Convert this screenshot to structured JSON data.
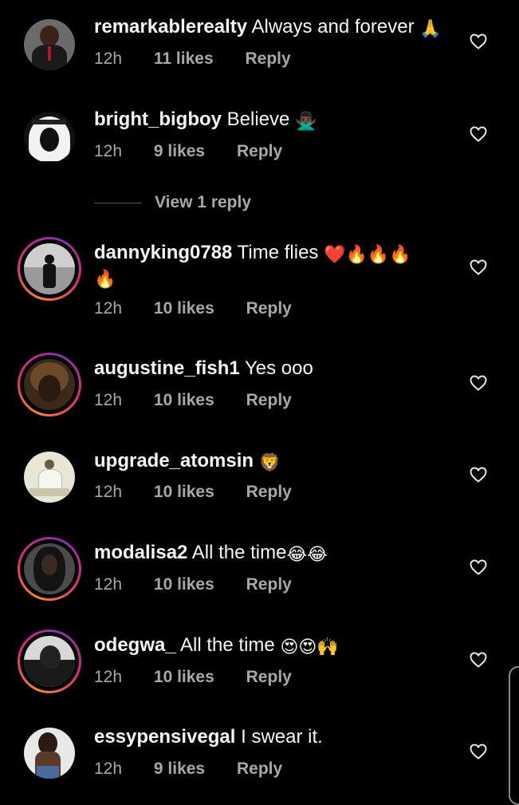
{
  "comments": [
    {
      "username": "remarkablerealty",
      "text": "Always and forever",
      "emoji": "🙏",
      "time": "12h",
      "likes": "11 likes",
      "reply": "Reply"
    },
    {
      "username": "bright_bigboy",
      "text": "Believe",
      "emoji": "🙅🏿‍♂️",
      "time": "12h",
      "likes": "9 likes",
      "reply": "Reply"
    },
    {
      "username": "dannyking0788",
      "text": "Time flies",
      "emoji": "❤️🔥🔥🔥",
      "emoji2": "🔥",
      "time": "12h",
      "likes": "10 likes",
      "reply": "Reply"
    },
    {
      "username": "augustine_fish1",
      "text": "Yes ooo",
      "emoji": "",
      "time": "12h",
      "likes": "10 likes",
      "reply": "Reply"
    },
    {
      "username": "upgrade_atomsin",
      "text": "",
      "emoji": "🦁",
      "time": "12h",
      "likes": "10 likes",
      "reply": "Reply"
    },
    {
      "username": "modalisa2",
      "text": "All the time",
      "emoji": "😂😂",
      "time": "12h",
      "likes": "10 likes",
      "reply": "Reply"
    },
    {
      "username": "odegwa_",
      "text": "All the time",
      "emoji": "😍😍🙌",
      "time": "12h",
      "likes": "10 likes",
      "reply": "Reply"
    },
    {
      "username": "essypensivegal",
      "text": "I swear it.",
      "emoji": "",
      "time": "12h",
      "likes": "9 likes",
      "reply": "Reply"
    }
  ],
  "view_replies_label": "View 1 reply"
}
